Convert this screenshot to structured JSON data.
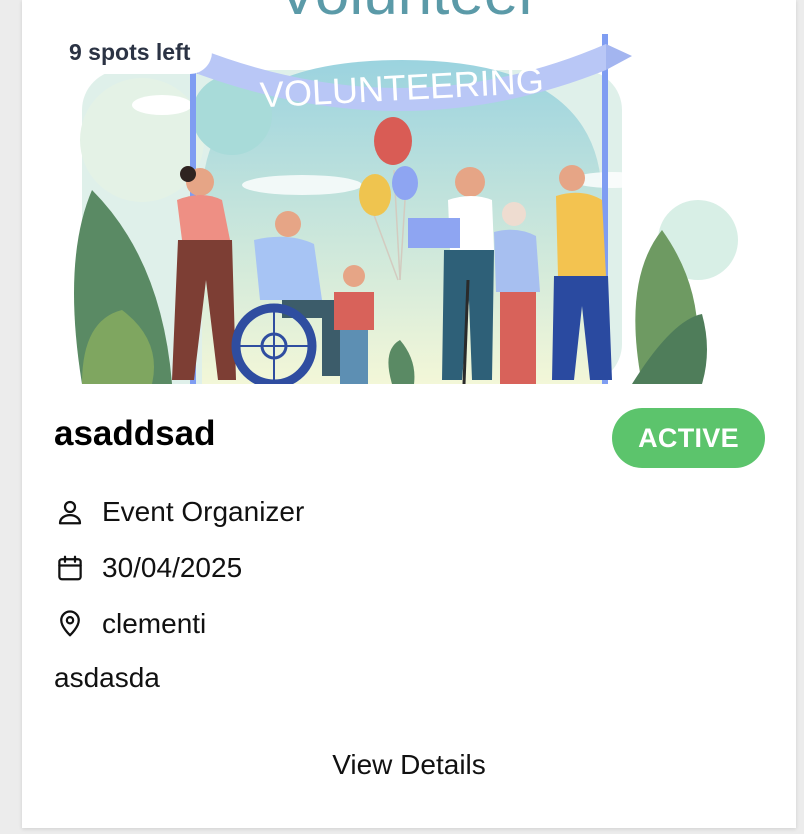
{
  "card": {
    "banner_text": "VOLUNTEERING",
    "top_word": "Volunteer",
    "spots_label": "9 spots left",
    "title": "asaddsad",
    "status": "ACTIVE",
    "organizer": "Event Organizer",
    "date": "30/04/2025",
    "location": "clementi",
    "description": "asdasda",
    "details_label": "View Details"
  },
  "icons": {
    "organizer": "person-icon",
    "date": "calendar-icon",
    "location": "map-pin-icon"
  },
  "colors": {
    "status_green": "#5cc46c",
    "banner": "#b9c7f6",
    "spots_text": "#2b3344"
  }
}
